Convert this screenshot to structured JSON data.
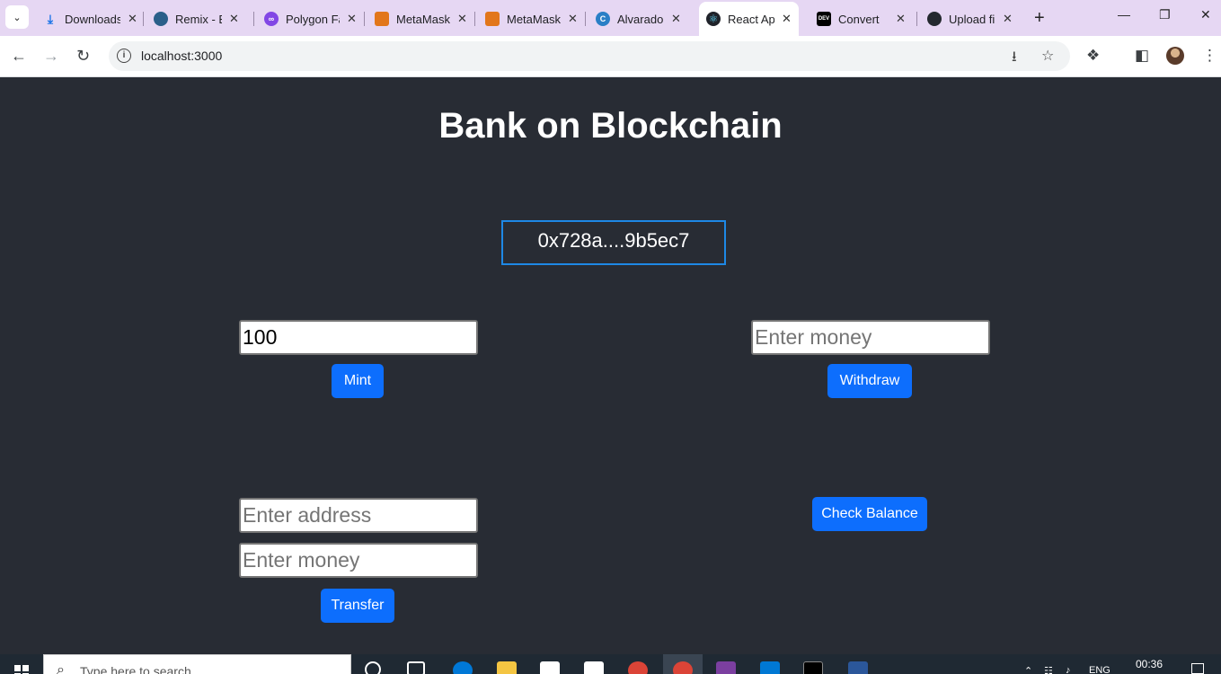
{
  "browser": {
    "tabs": [
      {
        "label": "Downloads",
        "icon": "download-icon",
        "color": "#1a73e8"
      },
      {
        "label": "Remix - Ethereum IDE",
        "icon": "remix-icon",
        "color": "#2a5f8a"
      },
      {
        "label": "Polygon Faucet",
        "icon": "polygon-icon",
        "color": "#8247e5"
      },
      {
        "label": "MetaMask",
        "icon": "metamask-fox-icon",
        "color": "#e2761b"
      },
      {
        "label": "MetaMask",
        "icon": "metamask-fox-icon",
        "color": "#e2761b"
      },
      {
        "label": "Alvarado",
        "icon": "canva-icon",
        "color": "#2a7fc6"
      },
      {
        "label": "React App",
        "icon": "react-icon",
        "color": "#61dafb",
        "active": true
      },
      {
        "label": "Convert",
        "icon": "dev-icon",
        "color": "#000000"
      },
      {
        "label": "Upload files",
        "icon": "github-icon",
        "color": "#24292f"
      }
    ],
    "url": "localhost:3000"
  },
  "app": {
    "title": "Bank on Blockchain",
    "account": "0x728a....9b5ec7",
    "mint_value": "100",
    "mint_label": "Mint",
    "withdraw_placeholder": "Enter money",
    "withdraw_label": "Withdraw",
    "address_placeholder": "Enter address",
    "transfer_money_placeholder": "Enter money",
    "transfer_label": "Transfer",
    "check_balance_label": "Check Balance"
  },
  "taskbar": {
    "search_placeholder": "Type here to search",
    "lang": "ENG",
    "time": "00:36"
  },
  "colors": {
    "app_bg": "#282c34",
    "button": "#0d6efd",
    "account_border": "#1e88e5",
    "tabstrip": "#e6d7f3"
  }
}
